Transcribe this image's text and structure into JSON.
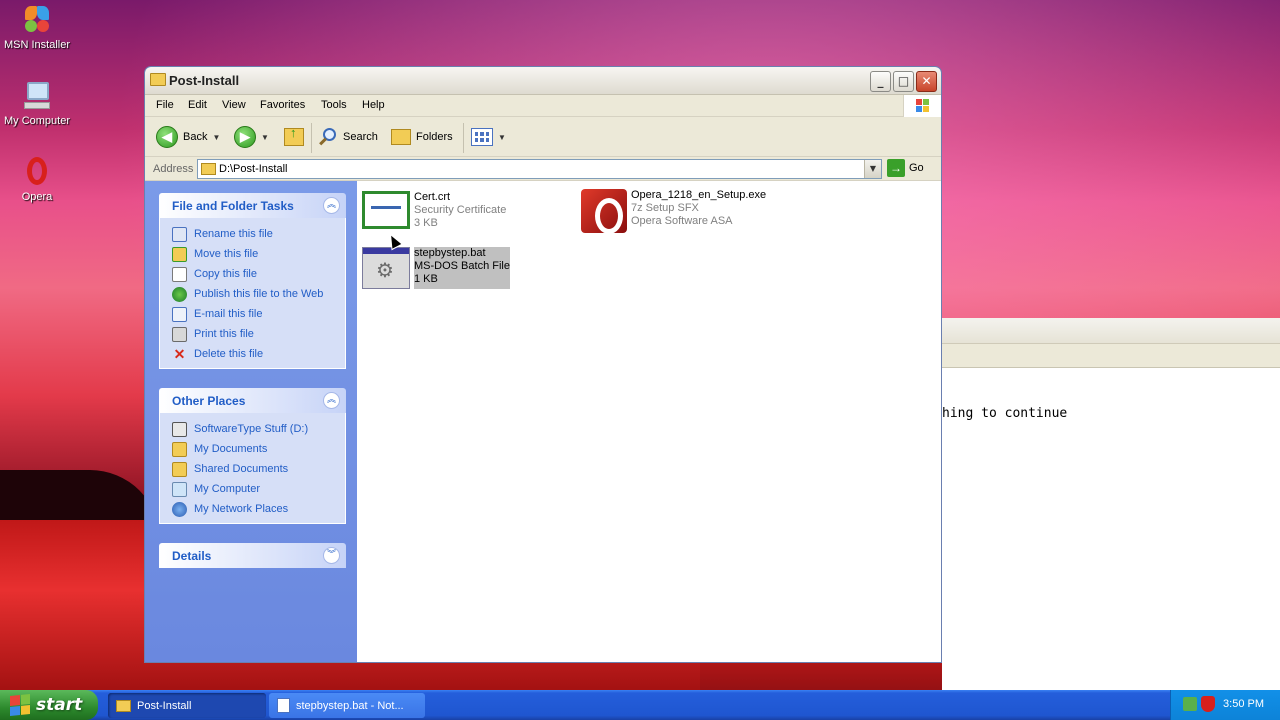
{
  "desktop": {
    "icons": [
      {
        "label": "MSN Installer"
      },
      {
        "label": "My Computer"
      },
      {
        "label": "Opera"
      }
    ]
  },
  "notepad_bg": {
    "visible_text": "hing to continue"
  },
  "window": {
    "title": "Post-Install",
    "menu": [
      "File",
      "Edit",
      "View",
      "Favorites",
      "Tools",
      "Help"
    ],
    "toolbar": {
      "back": "Back",
      "search": "Search",
      "folders": "Folders"
    },
    "address": {
      "label": "Address",
      "value": "D:\\Post-Install",
      "go": "Go"
    }
  },
  "sidebar": {
    "file_tasks": {
      "title": "File and Folder Tasks",
      "items": [
        {
          "label": "Rename this file",
          "icon": "rename-icon"
        },
        {
          "label": "Move this file",
          "icon": "move-icon"
        },
        {
          "label": "Copy this file",
          "icon": "copy-icon"
        },
        {
          "label": "Publish this file to the Web",
          "icon": "globe-icon"
        },
        {
          "label": "E-mail this file",
          "icon": "email-icon"
        },
        {
          "label": "Print this file",
          "icon": "print-icon"
        },
        {
          "label": "Delete this file",
          "icon": "delete-icon"
        }
      ]
    },
    "other_places": {
      "title": "Other Places",
      "items": [
        {
          "label": "SoftwareType Stuff (D:)",
          "icon": "drive-icon"
        },
        {
          "label": "My Documents",
          "icon": "documents-icon"
        },
        {
          "label": "Shared Documents",
          "icon": "folder-icon"
        },
        {
          "label": "My Computer",
          "icon": "computer-icon"
        },
        {
          "label": "My Network Places",
          "icon": "network-icon"
        }
      ]
    },
    "details": {
      "title": "Details"
    }
  },
  "files": [
    {
      "name": "Cert.crt",
      "type": "Security Certificate",
      "size": "3 KB"
    },
    {
      "name": "Opera_1218_en_Setup.exe",
      "type": "7z Setup SFX",
      "company": "Opera Software ASA"
    },
    {
      "name": "stepbystep.bat",
      "type": "MS-DOS Batch File",
      "size": "1 KB"
    }
  ],
  "taskbar": {
    "start": "start",
    "tasks": [
      {
        "label": "Post-Install"
      },
      {
        "label": "stepbystep.bat - Not..."
      }
    ],
    "clock": "3:50 PM"
  }
}
